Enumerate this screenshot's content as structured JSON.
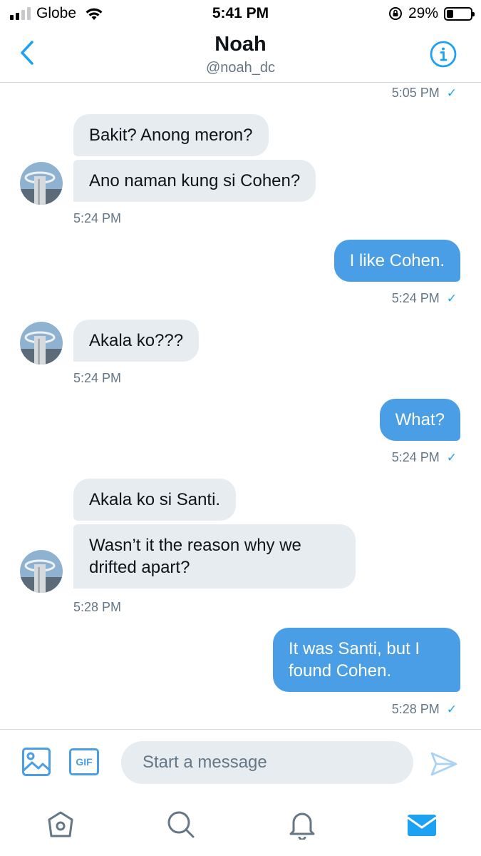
{
  "status_bar": {
    "carrier": "Globe",
    "time": "5:41 PM",
    "battery_percent": "29%",
    "battery_level": 0.29,
    "signal_bars": 2,
    "icons": [
      "signal-icon",
      "wifi-icon",
      "orientation-lock-icon",
      "battery-icon"
    ]
  },
  "header": {
    "title": "Noah",
    "handle": "@noah_dc",
    "icons": [
      "back-chevron-icon",
      "info-icon"
    ]
  },
  "messages": [
    {
      "type": "timestamp",
      "side": "out",
      "time": "5:05 PM",
      "read": true
    },
    {
      "type": "bubble",
      "side": "in",
      "text": "Bakit? Anong meron?"
    },
    {
      "type": "bubble",
      "side": "in",
      "text": "Ano naman kung si Cohen?"
    },
    {
      "type": "timestamp",
      "side": "in",
      "time": "5:24 PM"
    },
    {
      "type": "bubble",
      "side": "out",
      "text": "I like Cohen."
    },
    {
      "type": "timestamp",
      "side": "out",
      "time": "5:24 PM",
      "read": true
    },
    {
      "type": "bubble",
      "side": "in",
      "text": "Akala ko???"
    },
    {
      "type": "timestamp",
      "side": "in",
      "time": "5:24 PM"
    },
    {
      "type": "bubble",
      "side": "out",
      "text": "What?"
    },
    {
      "type": "timestamp",
      "side": "out",
      "time": "5:24 PM",
      "read": true
    },
    {
      "type": "bubble",
      "side": "in",
      "text": "Akala ko si Santi."
    },
    {
      "type": "bubble",
      "side": "in",
      "text": "Wasn’t it the reason why we drifted apart?"
    },
    {
      "type": "timestamp",
      "side": "in",
      "time": "5:28 PM"
    },
    {
      "type": "bubble",
      "side": "out",
      "text": "It was Santi, but I found Cohen."
    },
    {
      "type": "timestamp",
      "side": "out",
      "time": "5:28 PM",
      "read": true
    }
  ],
  "composer": {
    "gif_label": "GIF",
    "placeholder": "Start a message",
    "value": "",
    "icons": [
      "image-icon",
      "gif-icon",
      "send-icon"
    ]
  },
  "tab_bar": {
    "tabs": [
      {
        "name": "home",
        "icon": "home-icon",
        "active": false
      },
      {
        "name": "search",
        "icon": "search-icon",
        "active": false
      },
      {
        "name": "notifications",
        "icon": "bell-icon",
        "active": false
      },
      {
        "name": "messages",
        "icon": "mail-icon",
        "active": true
      }
    ]
  },
  "colors": {
    "accent": "#1da1f2",
    "outgoing_bubble": "#4a9ee6",
    "incoming_bubble": "#e6ecf0",
    "secondary_text": "#657786"
  }
}
